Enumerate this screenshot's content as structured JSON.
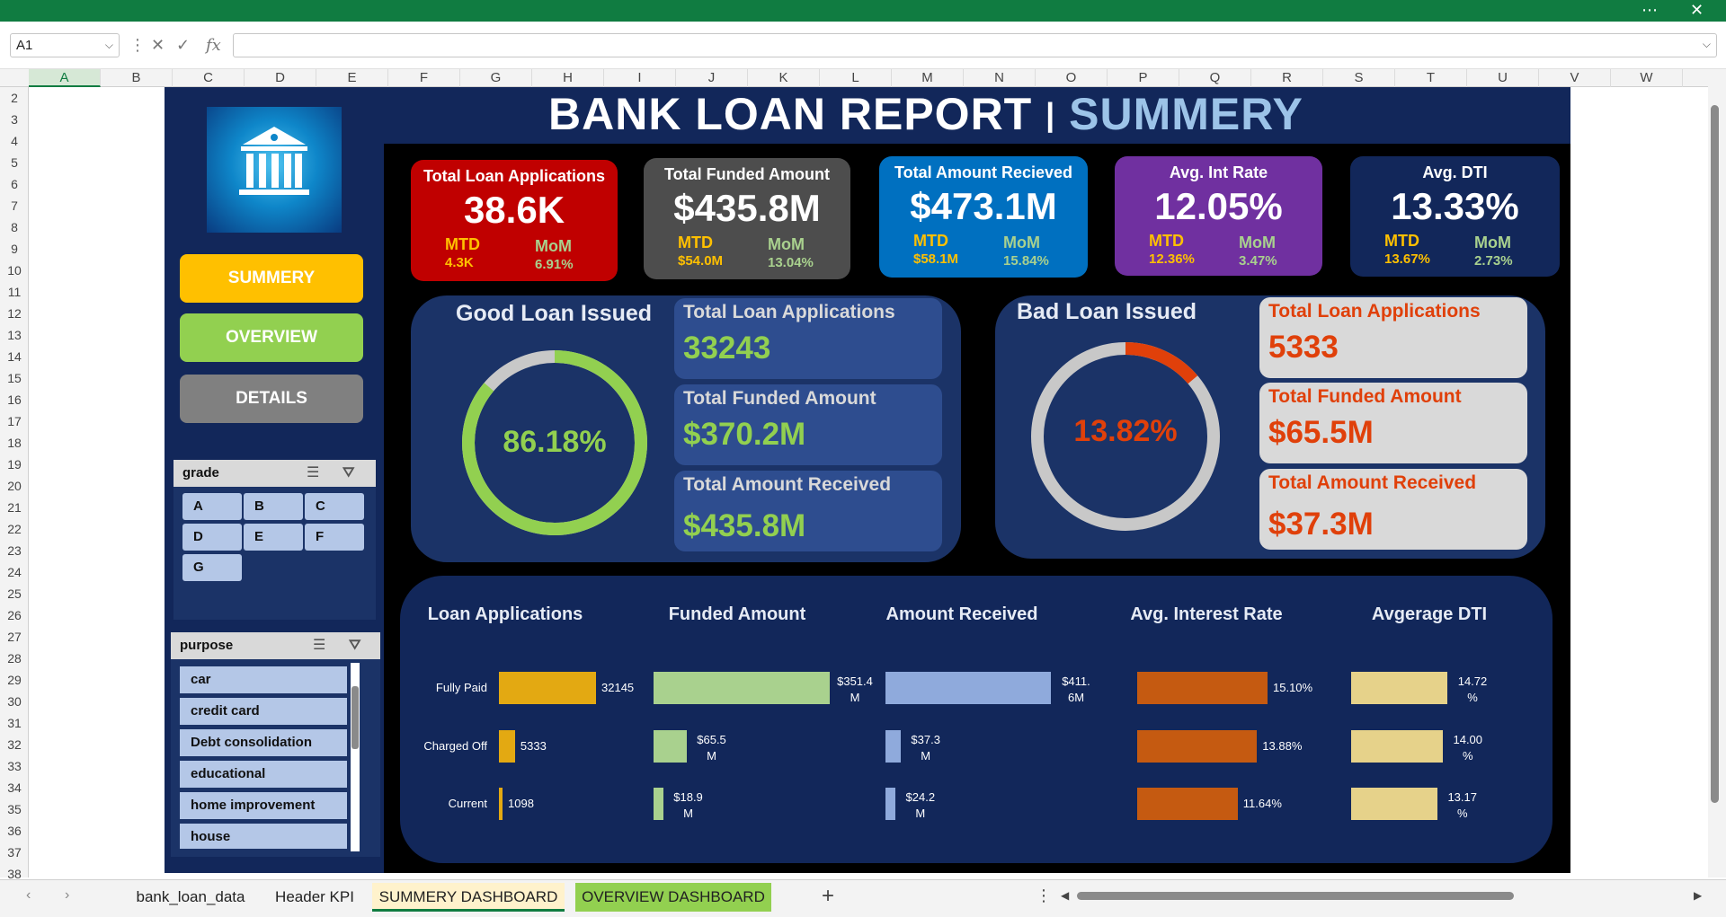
{
  "app": {
    "name_box": "A1",
    "formula": "",
    "columns": [
      "A",
      "B",
      "C",
      "D",
      "E",
      "F",
      "G",
      "H",
      "I",
      "J",
      "K",
      "L",
      "M",
      "N",
      "O",
      "P",
      "Q",
      "R",
      "S",
      "T",
      "U",
      "V",
      "W"
    ],
    "rows": [
      "2",
      "3",
      "4",
      "5",
      "6",
      "7",
      "8",
      "9",
      "10",
      "11",
      "12",
      "13",
      "14",
      "15",
      "16",
      "17",
      "18",
      "19",
      "20",
      "21",
      "22",
      "23",
      "24",
      "25",
      "26",
      "27",
      "28",
      "29",
      "30",
      "31",
      "32",
      "33",
      "34",
      "35",
      "36",
      "37",
      "38"
    ],
    "sheet_tabs": [
      "bank_loan_data",
      "Header KPI",
      "SUMMERY DASHBOARD",
      "OVERVIEW DASHBOARD"
    ],
    "active_tab": "SUMMERY DASHBOARD",
    "colors": {
      "excel_green": "#107c41",
      "dash_navy": "#12275a"
    }
  },
  "dashboard": {
    "title_main": "BANK LOAN REPORT",
    "title_sep": "|",
    "title_sub": "SUMMERY",
    "nav": {
      "summery": "SUMMERY",
      "overview": "OVERVIEW",
      "details": "DETAILS"
    },
    "grade_slicer": {
      "title": "grade",
      "items": [
        "A",
        "B",
        "C",
        "D",
        "E",
        "F",
        "G"
      ]
    },
    "purpose_slicer": {
      "title": "purpose",
      "items": [
        "car",
        "credit card",
        "Debt consolidation",
        "educational",
        "home improvement",
        "house"
      ]
    },
    "kpis": [
      {
        "title": "Total Loan Applications",
        "value": "38.6K",
        "mtd_label": "MTD",
        "mtd": "4.3K",
        "mom_label": "MoM",
        "mom": "6.91%",
        "color": "#c00000"
      },
      {
        "title": "Total Funded Amount",
        "value": "$435.8M",
        "mtd_label": "MTD",
        "mtd": "$54.0M",
        "mom_label": "MoM",
        "mom": "13.04%",
        "color": "#4d4d4d"
      },
      {
        "title": "Total Amount Recieved",
        "value": "$473.1M",
        "mtd_label": "MTD",
        "mtd": "$58.1M",
        "mom_label": "MoM",
        "mom": "15.84%",
        "color": "#0070c0"
      },
      {
        "title": "Avg. Int Rate",
        "value": "12.05%",
        "mtd_label": "MTD",
        "mtd": "12.36%",
        "mom_label": "MoM",
        "mom": "3.47%",
        "color": "#7030a0"
      },
      {
        "title": "Avg. DTI",
        "value": "13.33%",
        "mtd_label": "MTD",
        "mtd": "13.67%",
        "mom_label": "MoM",
        "mom": "2.73%",
        "color": "#12275a"
      }
    ],
    "good_loan": {
      "title": "Good Loan Issued",
      "pct": "86.18%",
      "fraction": 0.8618,
      "apps_label": "Total Loan Applications",
      "apps": "33243",
      "funded_label": "Total Funded Amount",
      "funded": "$370.2M",
      "received_label": "Total Amount Received",
      "received": "$435.8M"
    },
    "bad_loan": {
      "title": "Bad Loan Issued",
      "pct": "13.82%",
      "fraction": 0.1382,
      "apps_label": "Total Loan Applications",
      "apps": "5333",
      "funded_label": "Total Funded Amount",
      "funded": "$65.5M",
      "received_label": "Total Amount Received",
      "received": "$37.3M"
    }
  },
  "chart_data": [
    {
      "type": "bar",
      "title": "Loan Applications",
      "categories": [
        "Fully Paid",
        "Charged Off",
        "Current"
      ],
      "values": [
        32145,
        5333,
        1098
      ],
      "labels": [
        "32145",
        "5333",
        "1098"
      ],
      "color": "#e3a912"
    },
    {
      "type": "bar",
      "title": "Funded Amount",
      "categories": [
        "Fully Paid",
        "Charged Off",
        "Current"
      ],
      "values": [
        351.4,
        65.5,
        18.9
      ],
      "labels": [
        "$351.4 M",
        "$65.5 M",
        "$18.9 M"
      ],
      "color": "#a9d18e"
    },
    {
      "type": "bar",
      "title": "Amount Received",
      "categories": [
        "Fully Paid",
        "Charged Off",
        "Current"
      ],
      "values": [
        411.6,
        37.3,
        24.2
      ],
      "labels": [
        "$411. 6M",
        "$37.3 M",
        "$24.2 M"
      ],
      "color": "#8faadc"
    },
    {
      "type": "bar",
      "title": "Avg. Interest Rate",
      "categories": [
        "Fully Paid",
        "Charged Off",
        "Current"
      ],
      "values": [
        15.1,
        13.88,
        11.64
      ],
      "labels": [
        "15.10%",
        "13.88%",
        "11.64%"
      ],
      "color": "#c55a11"
    },
    {
      "type": "bar",
      "title": "Avgerage DTI",
      "categories": [
        "Fully Paid",
        "Charged Off",
        "Current"
      ],
      "values": [
        14.72,
        14.0,
        13.17
      ],
      "labels": [
        "14.72 %",
        "14.00 %",
        "13.17 %"
      ],
      "color": "#e6d28a"
    }
  ]
}
